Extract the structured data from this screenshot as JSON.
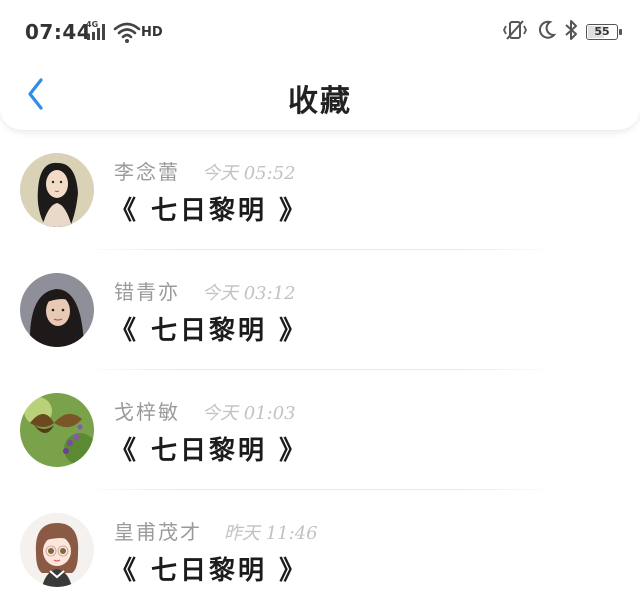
{
  "status_bar": {
    "time": "07:44",
    "network": "4G",
    "wifi_badge": "HD",
    "battery_level": "55",
    "icons": [
      "signal-icon",
      "wifi-icon",
      "vibrate-icon",
      "moon-icon",
      "bluetooth-icon",
      "battery-icon"
    ]
  },
  "header": {
    "title": "收藏",
    "back_icon": "chevron-left-icon",
    "accent": "#2d8ee6"
  },
  "favorites": [
    {
      "name": "李念蕾",
      "time": "今天 05:52",
      "book": "《 七日黎明 》",
      "avatar": "avatar-woman-painting"
    },
    {
      "name": "错青亦",
      "time": "今天 03:12",
      "book": "《 七日黎明 》",
      "avatar": "avatar-woman-photo"
    },
    {
      "name": "戈梓敏",
      "time": "今天 01:03",
      "book": "《 七日黎明 》",
      "avatar": "avatar-butterfly"
    },
    {
      "name": "皇甫茂才",
      "time": "昨天 11:46",
      "book": "《 七日黎明 》",
      "avatar": "avatar-anime-girl"
    }
  ]
}
